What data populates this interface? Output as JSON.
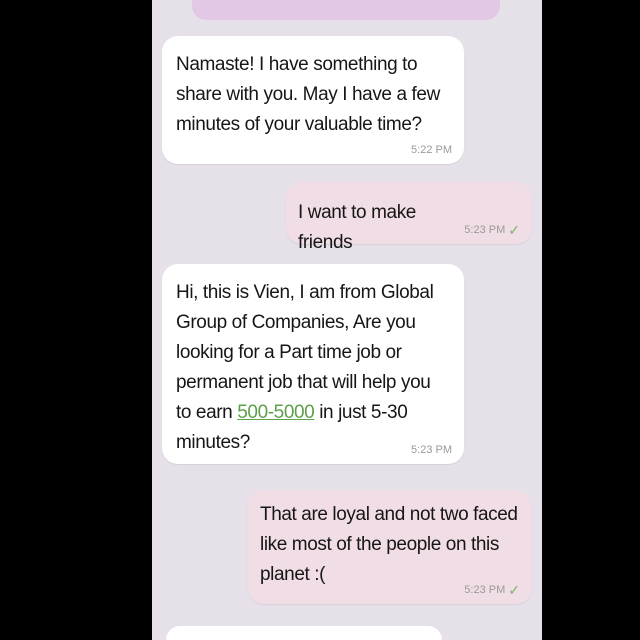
{
  "conversation": {
    "messages": [
      {
        "direction": "incoming",
        "text": "Namaste! I have something to share with you. May I have a few minutes of your valuable time?",
        "time": "5:22 PM"
      },
      {
        "direction": "outgoing",
        "text": "I want to make friends",
        "time": "5:23 PM",
        "status": "read"
      },
      {
        "direction": "incoming",
        "text_before_link": "Hi, this is Vien, I am from Global Group of Companies, Are you looking for a Part time job or permanent job that will help you  to earn ",
        "link_text": "500-5000",
        "text_after_link": " in just 5-30 minutes?",
        "time": "5:23 PM"
      },
      {
        "direction": "outgoing",
        "text": "That are loyal and not two faced like most of the people on this planet :(",
        "time": "5:23 PM",
        "status": "read"
      }
    ]
  },
  "icons": {
    "read_tick": "✓"
  },
  "colors": {
    "background": "#e6e1e9",
    "incoming_bubble": "#ffffff",
    "outgoing_bubble": "#f1dde5",
    "link": "#5ca04a",
    "tick": "#7fb06a"
  }
}
